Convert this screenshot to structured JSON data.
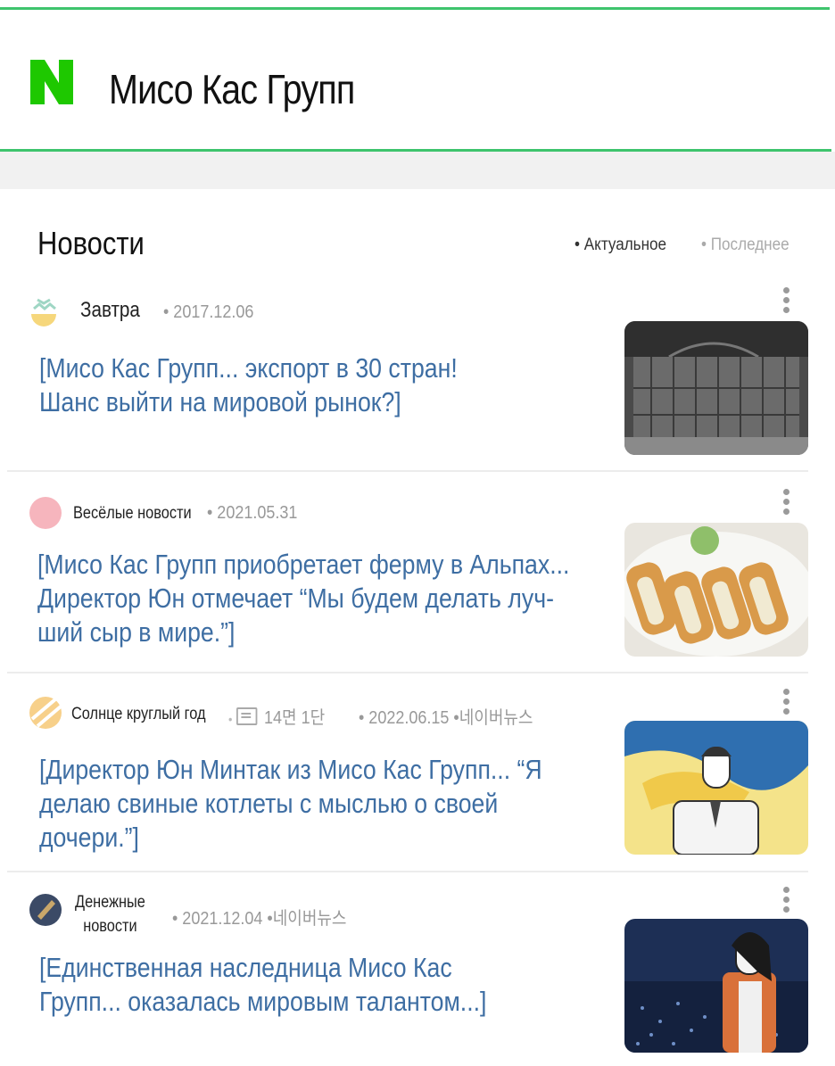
{
  "app": {
    "brand_letter": "N",
    "title": "Мисо Кас Групп"
  },
  "section": {
    "title": "Новости",
    "sort_options": [
      "• Актуальное",
      "• Последнее"
    ]
  },
  "colors": {
    "accent": "#3ec46d",
    "headline": "#3e6ea3"
  },
  "news": [
    {
      "source": "Завтра",
      "meta": "• 2017.12.06",
      "headline_line1": "[Мисо Кас Групп... экспорт в 30 стран!",
      "headline_line2": "Шанс выйти на мировой рынок?]",
      "icon": "sun-cloud-icon"
    },
    {
      "source": "Весёлые новости",
      "meta": "• 2021.05.31",
      "headline_line1": "[Мисо Кас Групп приобретает ферму в Альпах...",
      "headline_line2": "Директор Юн отмечает “Мы будем делать луч-",
      "headline_line3": "ший сыр в мире.”]",
      "icon": "pink-circle-icon"
    },
    {
      "source": "Солнце круглый год",
      "meta_paper": "14면 1단",
      "meta": "• 2022.06.15 •네이버뉴스",
      "headline_line1": "[Директор Юн Минтак из Мисо Кас Групп... “Я",
      "headline_line2": "делаю свиные котлеты с мыслью о своей дочери.”]",
      "icon": "sun-stripe-icon"
    },
    {
      "source_line1": "Денежные",
      "source_line2": "новости",
      "meta": "• 2021.12.04 •네이버뉴스",
      "headline_line1": "[Единственная наследница Мисо Кас",
      "headline_line2": "Групп... оказалась мировым талантом...]",
      "icon": "navy-circle-icon"
    }
  ]
}
